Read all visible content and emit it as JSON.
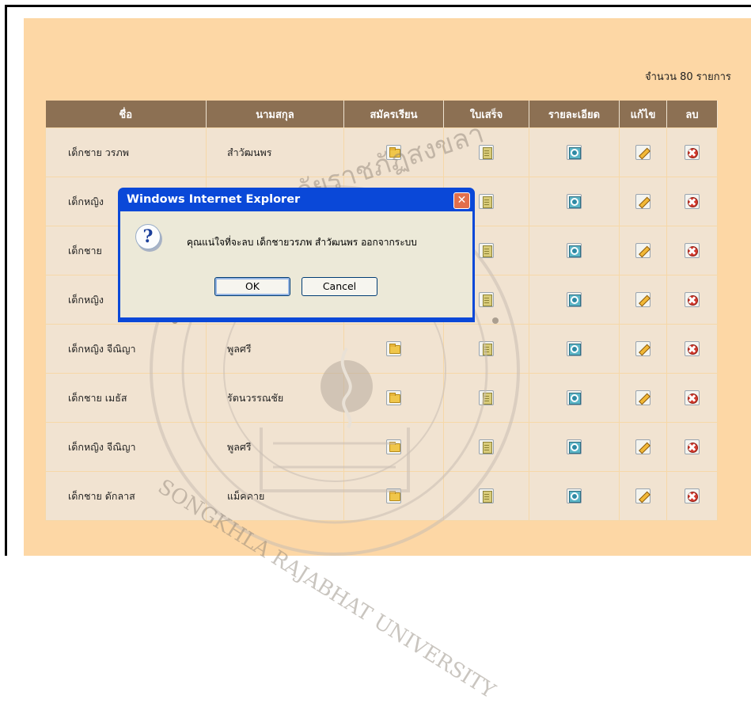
{
  "summary": {
    "count_text": "จำนวน 80 รายการ"
  },
  "table": {
    "headers": [
      "ชื่อ",
      "นามสกุล",
      "สมัครเรียน",
      "ใบเสร็จ",
      "รายละเอียด",
      "แก้ไข",
      "ลบ"
    ],
    "rows": [
      {
        "name": "เด็กชาย  วรภพ",
        "surname": "สำวัฒนพร"
      },
      {
        "name": "เด็กหญิง",
        "surname": ""
      },
      {
        "name": "เด็กชาย",
        "surname": ""
      },
      {
        "name": "เด็กหญิง",
        "surname": ""
      },
      {
        "name": "เด็กหญิง  จีณิญา",
        "surname": "พูลศรี"
      },
      {
        "name": "เด็กชาย  เมธัส",
        "surname": "รัตนวรรณชัย"
      },
      {
        "name": "เด็กหญิง  จีณิญา",
        "surname": "พูลศรี"
      },
      {
        "name": "เด็กชาย  ดักลาส",
        "surname": "แม็คคาย"
      }
    ],
    "row_icons": [
      "folder-icon",
      "receipt-icon",
      "details-icon",
      "edit-icon",
      "delete-icon"
    ]
  },
  "dialog": {
    "title": "Windows Internet Explorer",
    "message": "คุณแน่ใจที่จะลบ  เด็กชายวรภพ สำวัฒนพร  ออกจากระบบ",
    "ok_label": "OK",
    "cancel_label": "Cancel",
    "icon": "question-icon",
    "close_icon": "close-icon"
  },
  "colors": {
    "page_bg": "#fdd7a5",
    "header_bg": "#8c7053",
    "cell_bg": "#f1e3d1",
    "dialog_title_bg": "#0a48d8",
    "dialog_body_bg": "#ece9d8"
  },
  "watermark": {
    "bottom_text": "SONGKHLA RAJABHAT UNIVERSITY",
    "top_text": "มหาวิทยาลัยราชภัฏสงขลา"
  }
}
